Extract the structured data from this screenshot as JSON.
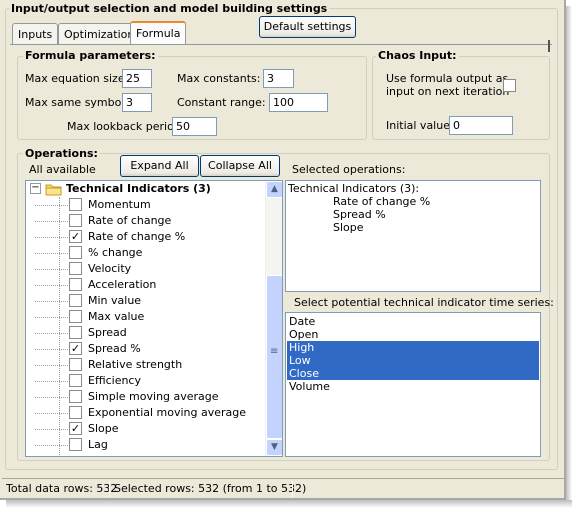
{
  "group_title": "Input/output selection and model building settings",
  "tabs": [
    {
      "label": "Inputs",
      "active": false
    },
    {
      "label": "Optimization",
      "active": false
    },
    {
      "label": "Formula",
      "active": true
    }
  ],
  "default_settings_label": "Default settings",
  "formula": {
    "title": "Formula parameters:",
    "max_equation_size_label": "Max equation size:",
    "max_equation_size_value": "25",
    "max_constants_label": "Max constants:",
    "max_constants_value": "3",
    "max_same_symbols_label": "Max same symbols:",
    "max_same_symbols_value": "3",
    "constant_range_label": "Constant range: ±",
    "constant_range_value": "100",
    "max_lookback_label": "Max lookback period:",
    "max_lookback_value": "50"
  },
  "chaos": {
    "title": "Chaos Input:",
    "use_output_line1": "Use formula output as",
    "use_output_line2": "input on next iteration",
    "use_output_checked": false,
    "initial_value_label": "Initial value:",
    "initial_value": "0"
  },
  "operations": {
    "title": "Operations:",
    "all_available_label": "All available",
    "expand_all_label": "Expand All",
    "collapse_all_label": "Collapse All",
    "tree_root": {
      "expander": "⊟",
      "label": "Technical Indicators (3)"
    },
    "tree_items": [
      {
        "label": "Momentum",
        "checked": false
      },
      {
        "label": "Rate of change",
        "checked": false
      },
      {
        "label": "Rate of change %",
        "checked": true
      },
      {
        "label": "% change",
        "checked": false
      },
      {
        "label": "Velocity",
        "checked": false
      },
      {
        "label": "Acceleration",
        "checked": false
      },
      {
        "label": "Min value",
        "checked": false
      },
      {
        "label": "Max value",
        "checked": false
      },
      {
        "label": "Spread",
        "checked": false
      },
      {
        "label": "Spread %",
        "checked": true
      },
      {
        "label": "Relative strength",
        "checked": false
      },
      {
        "label": "Efficiency",
        "checked": false
      },
      {
        "label": "Simple moving average",
        "checked": false
      },
      {
        "label": "Exponential moving average",
        "checked": false
      },
      {
        "label": "Slope",
        "checked": true
      },
      {
        "label": "Lag",
        "checked": false
      }
    ],
    "selected_label": "Selected operations:",
    "selected_header": "Technical Indicators (3):",
    "selected_items": [
      "Rate of change %",
      "Spread %",
      "Slope"
    ],
    "time_series_label": "Select potential technical indicator time series:",
    "time_series": [
      {
        "label": "Date",
        "selected": false
      },
      {
        "label": "Open",
        "selected": false
      },
      {
        "label": "High",
        "selected": true
      },
      {
        "label": "Low",
        "selected": true
      },
      {
        "label": "Close",
        "selected": true
      },
      {
        "label": "Volume",
        "selected": false
      }
    ]
  },
  "status": {
    "total_rows": "Total data rows: 532",
    "selected_rows": "Selected rows: 532  (from 1 to 532)"
  },
  "icons": {
    "folder": "folder-icon",
    "check": "✓",
    "scroll_up": "▲",
    "scroll_down": "▼",
    "grip": "≡"
  },
  "colors": {
    "selection": "#316ac5",
    "window_bg": "#ece9d8",
    "active_tab_accent": "#e68b2c"
  }
}
